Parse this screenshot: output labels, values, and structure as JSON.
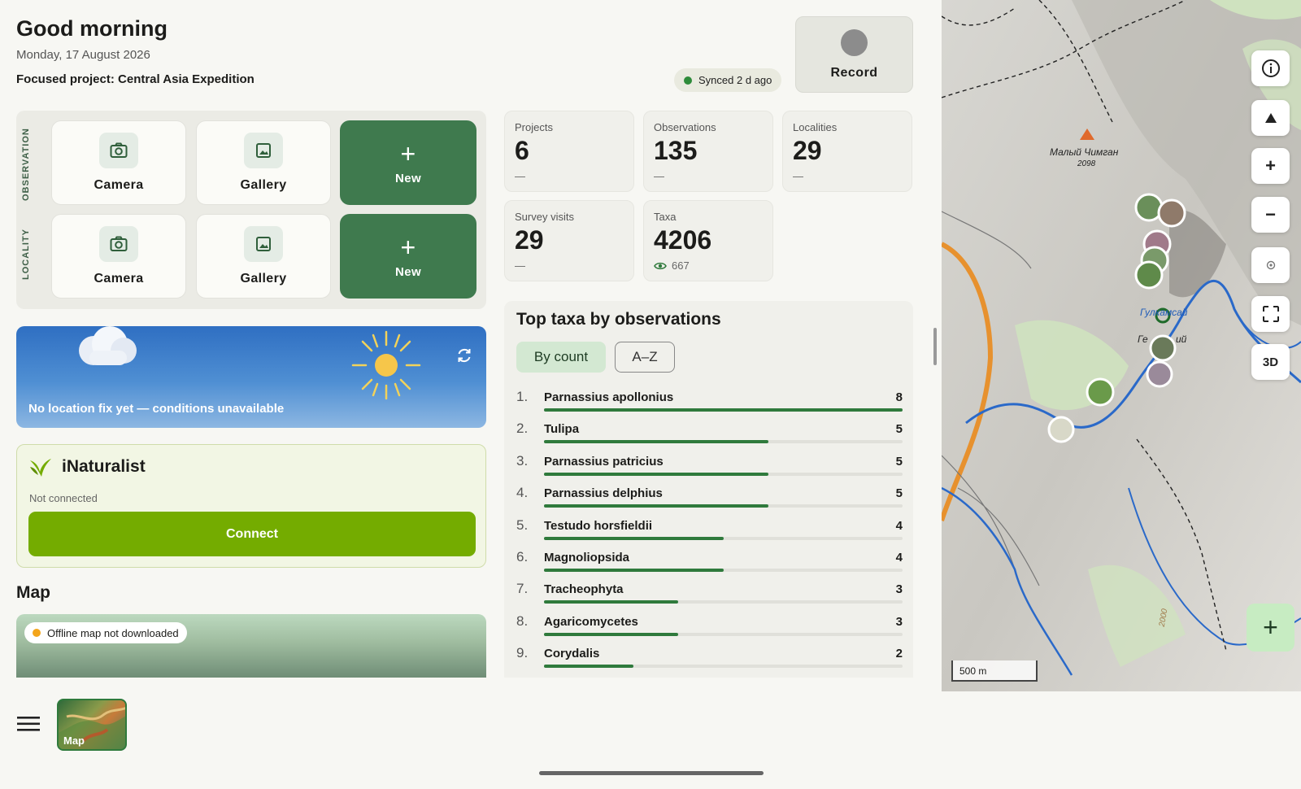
{
  "header": {
    "greeting": "Good morning",
    "date": "Monday, 17 August 2026",
    "focused_project": "Focused project: Central Asia Expedition",
    "sync_status": "Synced 2 d ago",
    "record_label": "Record"
  },
  "quick_actions": {
    "observation_label": "OBSERVATION",
    "locality_label": "LOCALITY",
    "camera": "Camera",
    "gallery": "Gallery",
    "new": "New"
  },
  "weather": {
    "message": "No location fix yet — conditions unavailable"
  },
  "inaturalist": {
    "title": "iNaturalist",
    "status": "Not connected",
    "connect_label": "Connect"
  },
  "map_section": {
    "heading": "Map",
    "offline_status": "Offline map not downloaded"
  },
  "bottom": {
    "map_thumb_label": "Map"
  },
  "stats": [
    {
      "label": "Projects",
      "value": "6",
      "sub": "—"
    },
    {
      "label": "Observations",
      "value": "135",
      "sub": "—"
    },
    {
      "label": "Localities",
      "value": "29",
      "sub": "—"
    },
    {
      "label": "Survey visits",
      "value": "29",
      "sub": "—"
    },
    {
      "label": "Taxa",
      "value": "4206",
      "sub": "667"
    }
  ],
  "top_taxa": {
    "title": "Top taxa by observations",
    "sort_by_count": "By count",
    "sort_az": "A–Z",
    "max": 8,
    "items": [
      {
        "rank": "1.",
        "name": "Parnassius apollonius",
        "count": "8",
        "value": 8
      },
      {
        "rank": "2.",
        "name": "Tulipa",
        "count": "5",
        "value": 5
      },
      {
        "rank": "3.",
        "name": "Parnassius patricius",
        "count": "5",
        "value": 5
      },
      {
        "rank": "4.",
        "name": "Parnassius delphius",
        "count": "5",
        "value": 5
      },
      {
        "rank": "5.",
        "name": "Testudo horsfieldii",
        "count": "4",
        "value": 4
      },
      {
        "rank": "6.",
        "name": "Magnoliopsida",
        "count": "4",
        "value": 4
      },
      {
        "rank": "7.",
        "name": "Tracheophyta",
        "count": "3",
        "value": 3
      },
      {
        "rank": "8.",
        "name": "Agaricomycetes",
        "count": "3",
        "value": 3
      },
      {
        "rank": "9.",
        "name": "Corydalis",
        "count": "2",
        "value": 2
      }
    ]
  },
  "big_map": {
    "peak_name": "Малый Чимган",
    "peak_elevation": "2098",
    "place_1": "Гулкамсай",
    "place_2": "Ге",
    "place_3": "ий",
    "contour_label": "2000",
    "scale_label": "500 m",
    "btn_3d": "3D"
  },
  "colors": {
    "accent": "#3f7a4e",
    "inaturalist": "#74ac00",
    "bar": "#2f7a3c"
  }
}
